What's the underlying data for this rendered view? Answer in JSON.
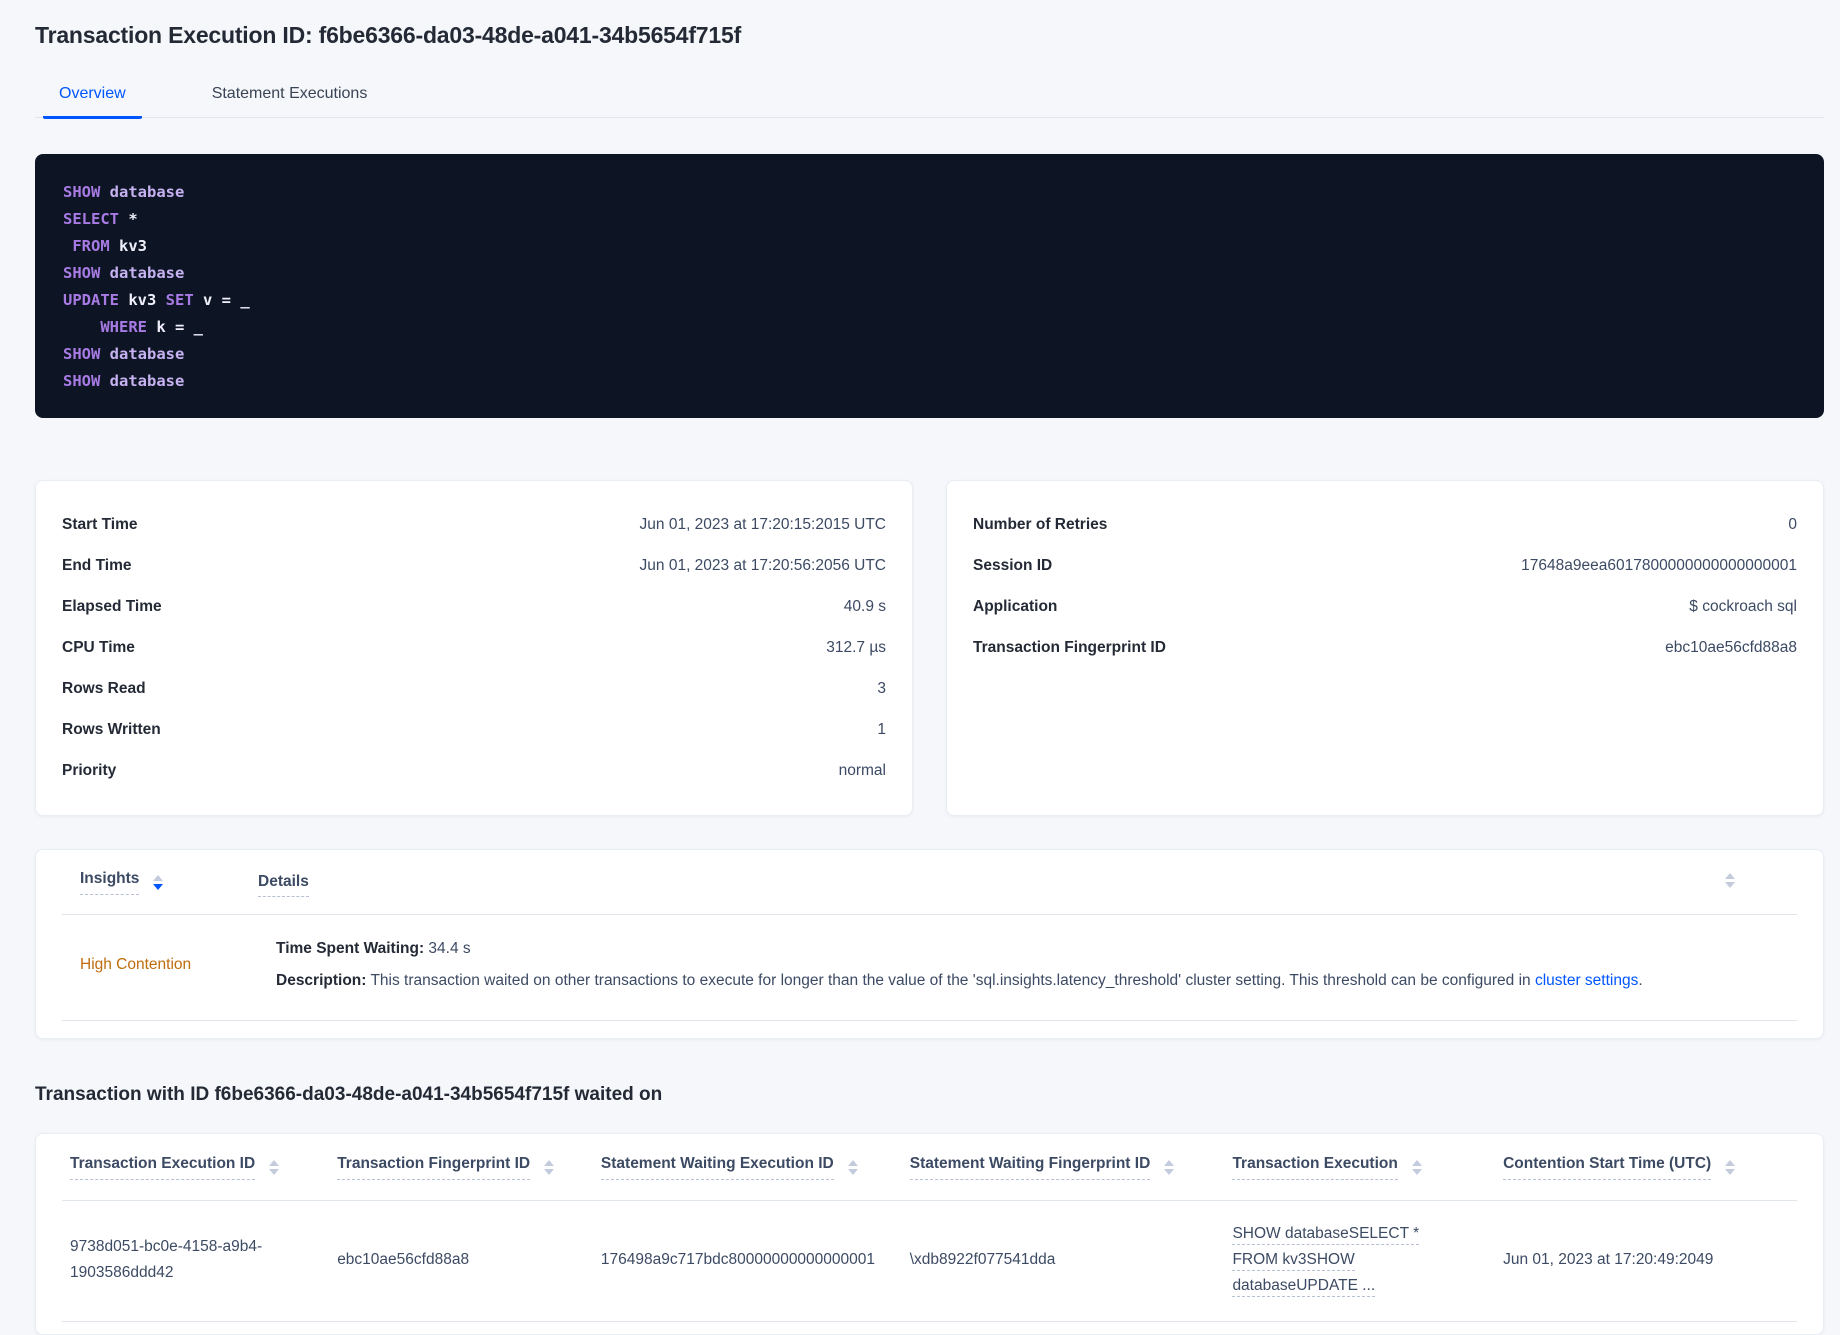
{
  "page": {
    "title": "Transaction Execution ID: f6be6366-da03-48de-a041-34b5654f715f"
  },
  "tabs": [
    {
      "label": "Overview",
      "active": true
    },
    {
      "label": "Statement Executions",
      "active": false
    }
  ],
  "sql_box": {
    "lines": [
      [
        {
          "c": "kw",
          "t": "SHOW"
        },
        {
          "c": "pl",
          "t": " "
        },
        {
          "c": "db",
          "t": "database"
        }
      ],
      [
        {
          "c": "kw",
          "t": "SELECT"
        },
        {
          "c": "pl",
          "t": " *"
        }
      ],
      [
        {
          "c": "pl",
          "t": " "
        },
        {
          "c": "kw",
          "t": "FROM"
        },
        {
          "c": "pl",
          "t": " kv3"
        }
      ],
      [
        {
          "c": "kw",
          "t": "SHOW"
        },
        {
          "c": "pl",
          "t": " "
        },
        {
          "c": "db",
          "t": "database"
        }
      ],
      [
        {
          "c": "kw",
          "t": "UPDATE"
        },
        {
          "c": "pl",
          "t": " kv3 "
        },
        {
          "c": "kw",
          "t": "SET"
        },
        {
          "c": "pl",
          "t": " v = _"
        }
      ],
      [
        {
          "c": "pl",
          "t": "    "
        },
        {
          "c": "kw",
          "t": "WHERE"
        },
        {
          "c": "pl",
          "t": " k = _"
        }
      ],
      [
        {
          "c": "kw",
          "t": "SHOW"
        },
        {
          "c": "pl",
          "t": " "
        },
        {
          "c": "db",
          "t": "database"
        }
      ],
      [
        {
          "c": "kw",
          "t": "SHOW"
        },
        {
          "c": "pl",
          "t": " "
        },
        {
          "c": "db",
          "t": "database"
        }
      ]
    ]
  },
  "details_card": {
    "rows": [
      {
        "label": "Start Time",
        "value": "Jun 01, 2023 at 17:20:15:2015 UTC"
      },
      {
        "label": "End Time",
        "value": "Jun 01, 2023 at 17:20:56:2056 UTC"
      },
      {
        "label": "Elapsed Time",
        "value": "40.9 s"
      },
      {
        "label": "CPU Time",
        "value": "312.7 µs"
      },
      {
        "label": "Rows Read",
        "value": "3"
      },
      {
        "label": "Rows Written",
        "value": "1"
      },
      {
        "label": "Priority",
        "value": "normal"
      }
    ]
  },
  "session_card": {
    "rows": [
      {
        "label": "Number of Retries",
        "value": "0"
      },
      {
        "label": "Session ID",
        "value": "17648a9eea6017800000000000000001"
      },
      {
        "label": "Application",
        "value": "$ cockroach sql"
      },
      {
        "label": "Transaction Fingerprint ID",
        "value": "ebc10ae56cfd88a8"
      }
    ]
  },
  "insights_table": {
    "columns": [
      "Insights",
      "Details"
    ],
    "row": {
      "insight": "High Contention",
      "waiting_label": "Time Spent Waiting:",
      "waiting_value": " 34.4 s",
      "description_label": "Description:",
      "description_text": " This transaction waited on other transactions to execute for longer than the value of the 'sql.insights.latency_threshold' cluster setting. This threshold can be configured in ",
      "description_link": "cluster settings",
      "description_suffix": "."
    }
  },
  "waited_section": {
    "heading": "Transaction with ID f6be6366-da03-48de-a041-34b5654f715f waited on",
    "columns": [
      "Transaction Execution ID",
      "Transaction Fingerprint ID",
      "Statement Waiting Execution ID",
      "Statement Waiting Fingerprint ID",
      "Transaction Execution",
      "Contention Start Time (UTC)"
    ],
    "row": {
      "transaction_execution_id": "9738d051-bc0e-4158-a9b4-1903586ddd42",
      "transaction_fingerprint_id": "ebc10ae56cfd88a8",
      "statement_waiting_execution_id": "176498a9c717bdc80000000000000001",
      "statement_waiting_fingerprint_id": "\\xdb8922f077541dda",
      "transaction_execution_lines": [
        "SHOW databaseSELECT *",
        "FROM kv3SHOW",
        "databaseUPDATE ..."
      ],
      "contention_start_time": "Jun 01, 2023 at 17:20:49:2049"
    }
  },
  "colors": {
    "accent_blue": "#0055ff",
    "warning_orange": "#bf6c0d",
    "code_background": "#0d1525",
    "sql_keyword": "#a87be4",
    "sql_identifier": "#c7b2f1",
    "sql_text": "#eff0fb",
    "page_background": "#f5f7fa",
    "heading_text": "#242a35",
    "body_text": "#3c4a63"
  }
}
